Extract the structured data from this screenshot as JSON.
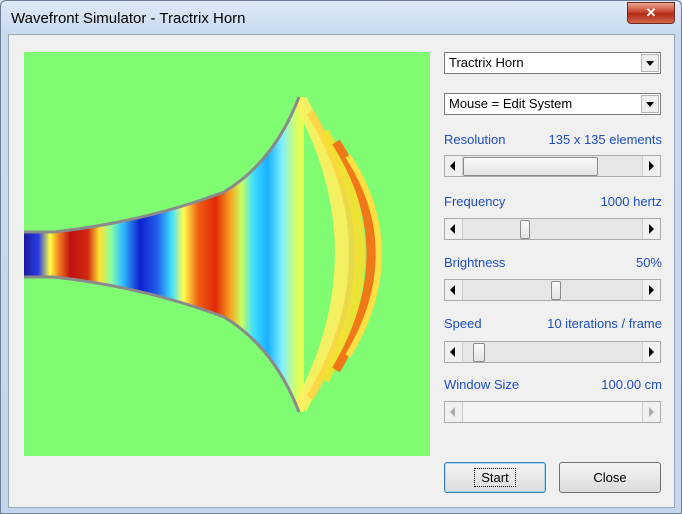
{
  "window": {
    "title": "Wavefront Simulator - Tractrix Horn",
    "close_glyph": "✕"
  },
  "selectors": {
    "system": "Tractrix Horn",
    "mouse_mode": "Mouse = Edit System"
  },
  "controls": [
    {
      "label": "Resolution",
      "value": "135 x 135 elements",
      "level": 0.77,
      "enabled": true
    },
    {
      "label": "Frequency",
      "value": "1000 hertz",
      "level": 0.32,
      "enabled": true
    },
    {
      "label": "Brightness",
      "value": "50%",
      "level": 0.5,
      "enabled": true
    },
    {
      "label": "Speed",
      "value": "10 iterations / frame",
      "level": 0.06,
      "enabled": true
    },
    {
      "label": "Window Size",
      "value": "100.00 cm",
      "level": 0.0,
      "enabled": false
    }
  ],
  "buttons": {
    "start": "Start",
    "close": "Close"
  },
  "colors": {
    "background": "#80fc72",
    "horn_wall": "#8a8a8a",
    "accent_label": "#1f4ebf"
  }
}
